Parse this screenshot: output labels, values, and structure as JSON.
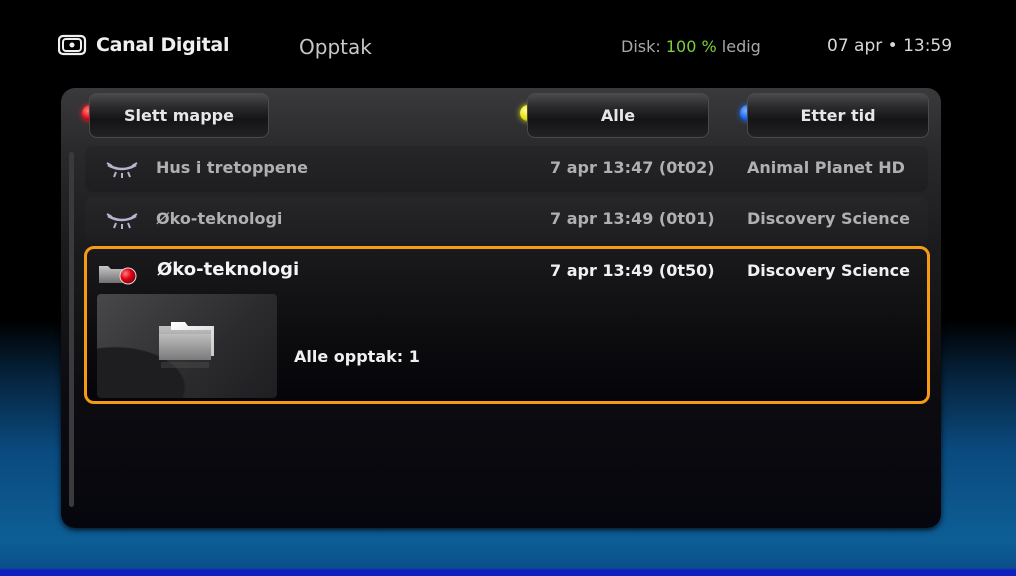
{
  "header": {
    "brand": "Canal Digital",
    "title": "Opptak",
    "disk_label": "Disk:",
    "disk_value": "100 %",
    "disk_suffix": "ledig",
    "datetime": "07 apr • 13:59"
  },
  "buttons": [
    {
      "label": "Slett mappe",
      "color_key": "red",
      "color": "#e00010"
    },
    {
      "label": "Alle",
      "color_key": "yellow",
      "color": "#e0e000"
    },
    {
      "label": "Etter tid",
      "color_key": "blue",
      "color": "#1060f0"
    }
  ],
  "recordings": [
    {
      "icon": "eye-closed-icon",
      "title": "Hus i tretoppene",
      "time": "7 apr 13:47 (0t02)",
      "channel": "Animal Planet HD"
    },
    {
      "icon": "eye-closed-icon",
      "title": "Øko-teknologi",
      "time": "7 apr 13:49 (0t01)",
      "channel": "Discovery Science"
    }
  ],
  "selected": {
    "icon": "recording-folder-icon",
    "title": "Øko-teknologi",
    "time": "7 apr 13:49 (0t50)",
    "channel": "Discovery Science",
    "info": "Alle opptak: 1",
    "highlight_color": "#f59b14"
  }
}
